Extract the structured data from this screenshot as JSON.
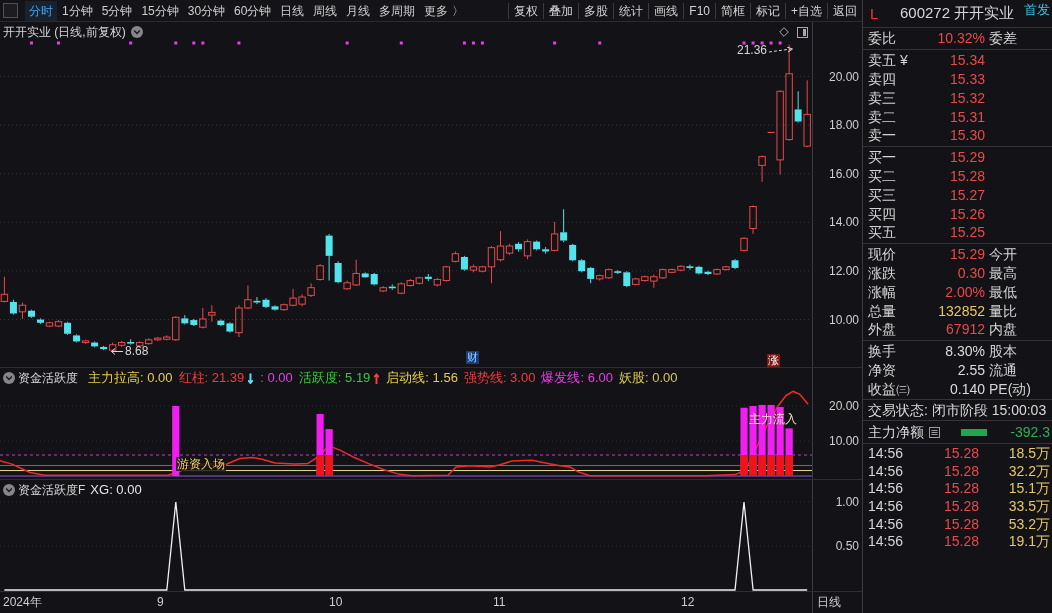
{
  "toolbar": {
    "periods": [
      {
        "label": "分时",
        "selected": true
      },
      {
        "label": "1分钟",
        "selected": false
      },
      {
        "label": "5分钟",
        "selected": false
      },
      {
        "label": "15分钟",
        "selected": false
      },
      {
        "label": "30分钟",
        "selected": false
      },
      {
        "label": "60分钟",
        "selected": false
      },
      {
        "label": "日线",
        "selected": false
      },
      {
        "label": "周线",
        "selected": false
      },
      {
        "label": "月线",
        "selected": false
      },
      {
        "label": "多周期",
        "selected": false
      },
      {
        "label": "更多 〉",
        "selected": false
      }
    ],
    "buttons": [
      "复权",
      "叠加",
      "多股",
      "统计",
      "画线",
      "F10",
      "简框",
      "标记",
      "+自选",
      "返回"
    ]
  },
  "main_chart": {
    "title": "开开实业 (日线,前复权)",
    "high_label": "21.36",
    "low_label": "8.68",
    "price_axis": [
      "20.00",
      "18.00",
      "16.00",
      "14.00",
      "12.00",
      "10.00"
    ],
    "markers": [
      {
        "kind": "news",
        "text": "财"
      },
      {
        "kind": "limit_up",
        "text": "涨"
      }
    ]
  },
  "indicator_1": {
    "name": "资金活跃度",
    "legend": [
      {
        "kind": "value",
        "text": "主力拉高: 0.00",
        "color": "#e6cf48"
      },
      {
        "kind": "value",
        "text": "红柱: 21.39",
        "color": "#f03c3c"
      },
      {
        "kind": "arrow",
        "text": "↓",
        "color": "#5ce0ee"
      },
      {
        "kind": "value",
        "text": ": 0.00",
        "color": "#e83ce8"
      },
      {
        "kind": "value",
        "text": "活跃度: 5.19",
        "color": "#3cc83c"
      },
      {
        "kind": "arrow",
        "text": "↑",
        "color": "#ff3c3c"
      },
      {
        "kind": "value",
        "text": "启动线: 1.56",
        "color": "#e6cf49"
      },
      {
        "kind": "value",
        "text": "强势线: 3.00",
        "color": "#f03c3e"
      },
      {
        "kind": "value",
        "text": "爆发线: 6.00",
        "color": "#e83ce9"
      },
      {
        "kind": "value",
        "text": "妖股: 0.00",
        "color": "#d8c850"
      }
    ],
    "axis": [
      "20.00",
      "10.00"
    ],
    "annotations": [
      "游资入场",
      "主力流入"
    ]
  },
  "indicator_2": {
    "name": "资金活跃度F",
    "reading": ": 0.00",
    "chart_data": {
      "type": "line",
      "ylim": [
        0,
        1
      ],
      "yticks": [
        {
          "value": 1,
          "label": "1.00"
        },
        {
          "value": 0.5,
          "label": "0.50"
        }
      ],
      "series": [
        {
          "name": "XG",
          "color": "#f0f0f0",
          "values": [
            0,
            0,
            0,
            0,
            0,
            0,
            0,
            0,
            0,
            0,
            0,
            0,
            0,
            0,
            0,
            0,
            0,
            0,
            0,
            1,
            0,
            0,
            0,
            0,
            0,
            0,
            0,
            0,
            0,
            0,
            0,
            0,
            0,
            0,
            0,
            0,
            0,
            0,
            0,
            0,
            0,
            0,
            0,
            0,
            0,
            0,
            0,
            0,
            0,
            0,
            0,
            0,
            0,
            0,
            0,
            0,
            0,
            0,
            0,
            0,
            0,
            0,
            0,
            0,
            0,
            0,
            0,
            0,
            0,
            0,
            0,
            0,
            0,
            0,
            0,
            0,
            0,
            0,
            0,
            0,
            0,
            0,
            1,
            0,
            0,
            0,
            0,
            0,
            0,
            0
          ]
        }
      ]
    }
  },
  "date_axis": {
    "labels": [
      "2024年",
      "9",
      "10",
      "11",
      "12"
    ],
    "period": "日线"
  },
  "quote": {
    "flag": "L",
    "title": "600272 开开实业",
    "badge": "首发",
    "sections": [
      {
        "rows": [
          {
            "label": "委比",
            "value": "10.32%",
            "color": "#e84a4a",
            "label_right": "委差"
          }
        ]
      },
      {
        "rows": [
          {
            "label": "卖五 ¥",
            "value": "15.34",
            "color": "#e84a4a"
          },
          {
            "label": "卖四",
            "value": "15.33",
            "color": "#e84a4a"
          },
          {
            "label": "卖三",
            "value": "15.32",
            "color": "#e84a4a"
          },
          {
            "label": "卖二",
            "value": "15.31",
            "color": "#e84a4a"
          },
          {
            "label": "卖一",
            "value": "15.30",
            "color": "#e84a4a"
          }
        ]
      },
      {
        "rows": [
          {
            "label": "买一",
            "value": "15.29",
            "color": "#e84a4a"
          },
          {
            "label": "买二",
            "value": "15.28",
            "color": "#e84a4a"
          },
          {
            "label": "买三",
            "value": "15.27",
            "color": "#e84a4a"
          },
          {
            "label": "买四",
            "value": "15.26",
            "color": "#e84a4a"
          },
          {
            "label": "买五",
            "value": "15.25",
            "color": "#e84a4a"
          }
        ]
      },
      {
        "rows": [
          {
            "label": "现价",
            "value": "15.29",
            "color": "#e84a4a",
            "label_right": "今开"
          },
          {
            "label": "涨跌",
            "value": "0.30",
            "color": "#e84a4a",
            "label_right": "最高"
          },
          {
            "label": "涨幅",
            "value": "2.00%",
            "color": "#e84a4a",
            "label_right": "最低"
          },
          {
            "label": "总量",
            "value": "132852",
            "color": "#e8c866",
            "label_right": "量比"
          },
          {
            "label": "外盘",
            "value": "67912",
            "color": "#e84a4a",
            "label_right": "内盘"
          }
        ]
      },
      {
        "rows": [
          {
            "label": "换手",
            "value": "8.30%",
            "color": "#dcdcdc",
            "label_right": "股本"
          },
          {
            "label": "净资",
            "value": "2.55",
            "color": "#dcdcdc",
            "label_right": "流通"
          },
          {
            "label": "收益㈢",
            "value": "0.140",
            "color": "#dcdcdc",
            "label_right": "PE(动)"
          }
        ]
      }
    ],
    "status": "交易状态: 闭市阶段 15:00:03",
    "net_flow": {
      "label": "主力净额",
      "value": "-392.3"
    },
    "trades": [
      {
        "time": "14:56",
        "price": "15.28",
        "volume": "18.5万"
      },
      {
        "time": "14:56",
        "price": "15.28",
        "volume": "32.2万"
      },
      {
        "time": "14:56",
        "price": "15.28",
        "volume": "15.1万"
      },
      {
        "time": "14:56",
        "price": "15.28",
        "volume": "33.5万"
      },
      {
        "time": "14:56",
        "price": "15.28",
        "volume": "53.2万"
      },
      {
        "time": "14:56",
        "price": "15.28",
        "volume": "19.1万"
      }
    ]
  }
}
